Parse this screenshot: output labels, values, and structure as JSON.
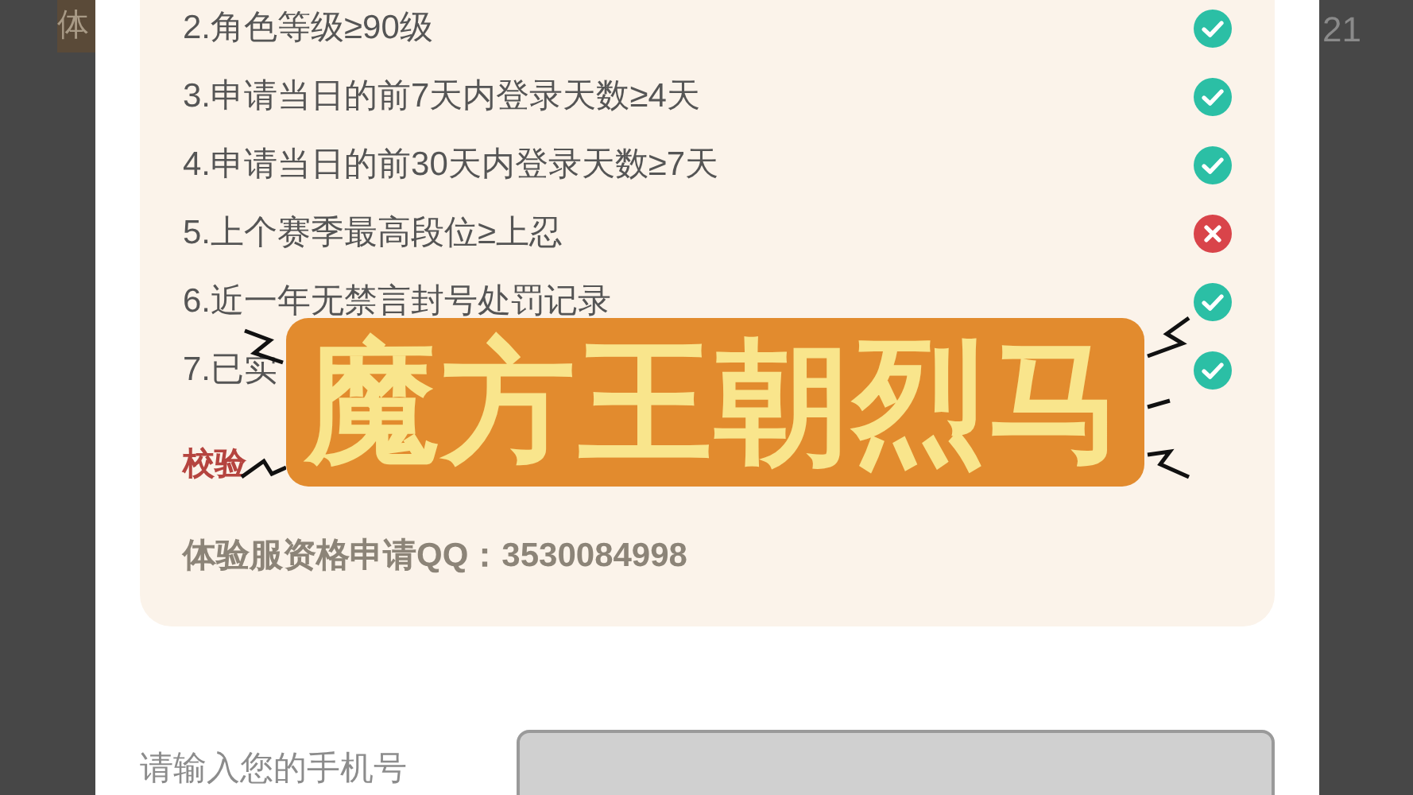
{
  "background": {
    "badge": "体",
    "count": "21"
  },
  "requirements": [
    {
      "label": "2.角色等级≥90级",
      "passed": true
    },
    {
      "label": "3.申请当日的前7天内登录天数≥4天",
      "passed": true
    },
    {
      "label": "4.申请当日的前30天内登录天数≥7天",
      "passed": true
    },
    {
      "label": "5.上个赛季最高段位≥上忍",
      "passed": false
    },
    {
      "label": "6.近一年无禁言封号处罚记录",
      "passed": true
    },
    {
      "label": "7.已实",
      "passed": true
    }
  ],
  "result_label": "校验",
  "contact": "体验服资格申请QQ：3530084998",
  "phone": {
    "label": "请输入您的手机号"
  },
  "caption": "魔方王朝烈马"
}
